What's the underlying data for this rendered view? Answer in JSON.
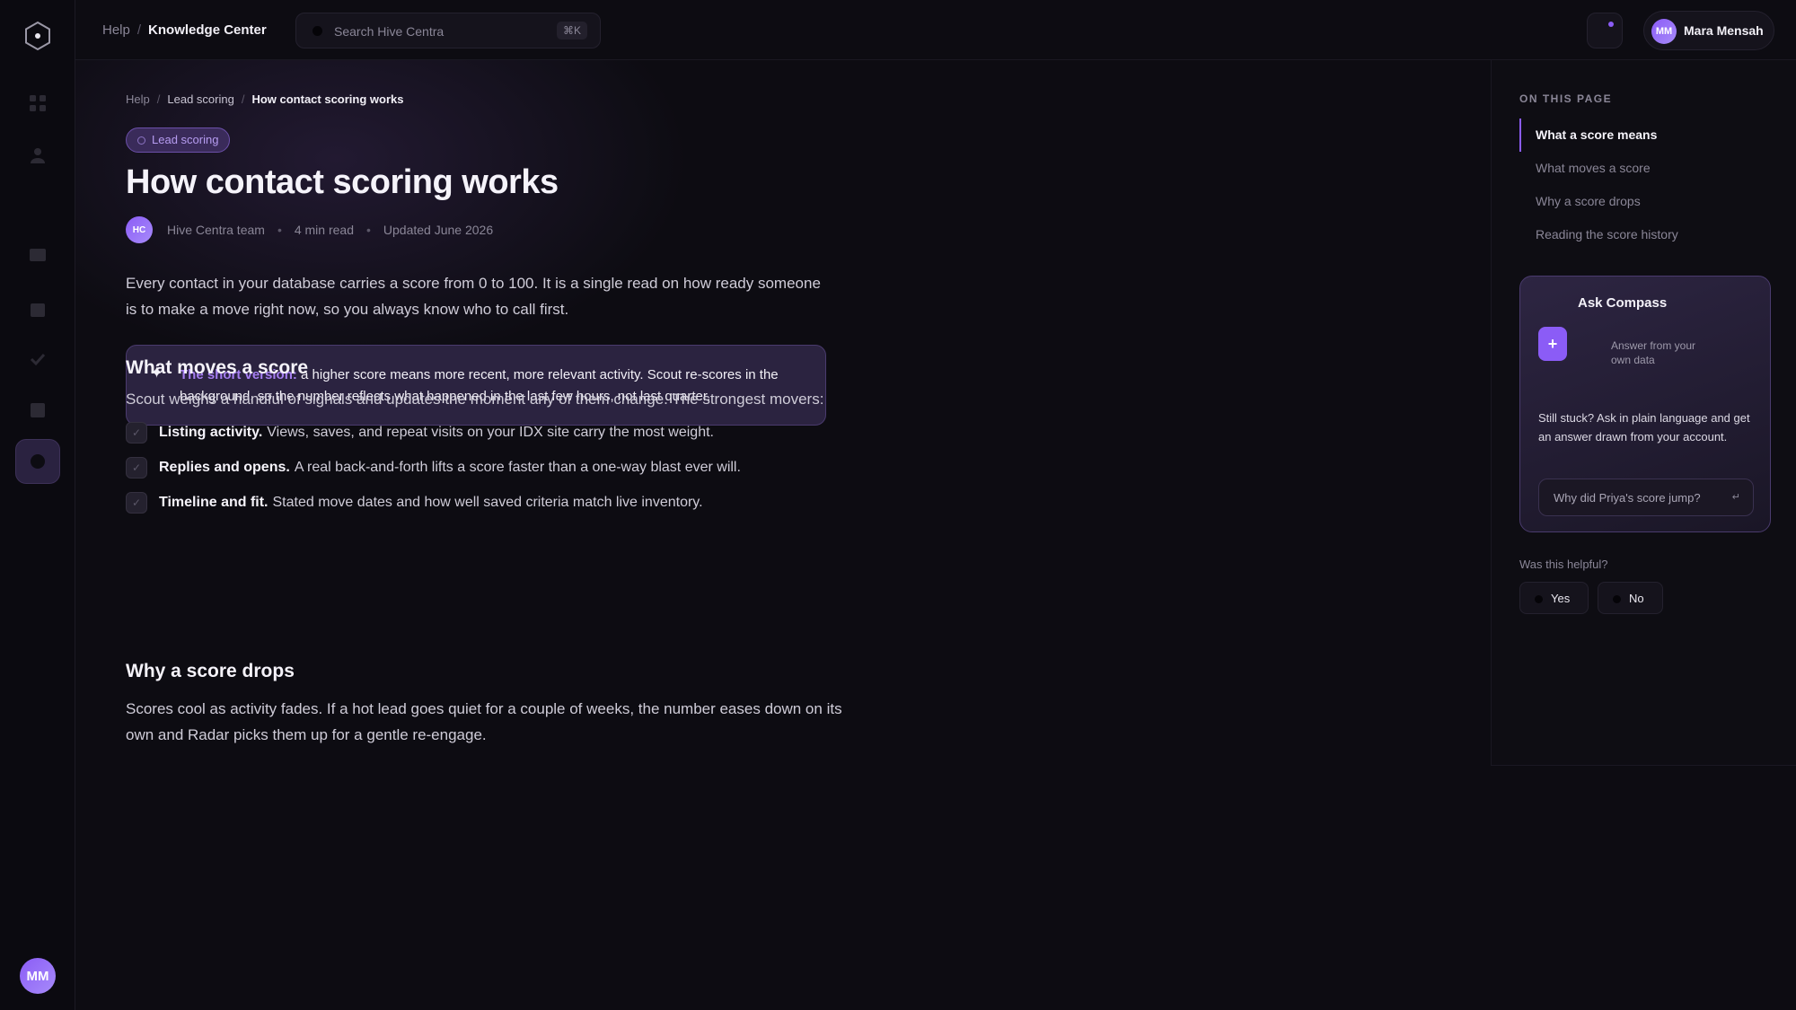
{
  "topbar": {
    "crumb_root": "Help",
    "crumb_current": "Knowledge Center",
    "search_placeholder": "Search Hive Centra",
    "search_shortcut": "⌘K",
    "user_initials": "MM",
    "user_name": "Mara Mensah"
  },
  "rail": {
    "avatar_initials": "MM",
    "icons": [
      "grid-icon",
      "contacts-icon",
      "inbox-icon",
      "calendar-icon",
      "tasks-icon",
      "reports-icon",
      "help-icon"
    ]
  },
  "article": {
    "breadcrumb": [
      "Help",
      "Lead scoring",
      "How contact scoring works"
    ],
    "tag": "Lead scoring",
    "title": "How contact scoring works",
    "author_initials": "HC",
    "author": "Hive Centra team",
    "read_time": "4 min read",
    "updated": "Updated June 2026",
    "intro": "Every contact in your database carries a score from 0 to 100. It is a single read on how ready someone is to make a move right now, so you always know who to call first.",
    "callout": {
      "lead": "The short version:",
      "text": " a higher score means more recent, more relevant activity. Scout re-scores in the background, so the number reflects what happened in the last few hours, not last quarter."
    },
    "section1": {
      "heading": "What moves a score",
      "intro": "Scout weighs a handful of signals and updates the moment any of them change. The strongest movers:",
      "items": [
        {
          "bold": "Listing activity.",
          "text": "Views, saves, and repeat visits on your IDX site carry the most weight."
        },
        {
          "bold": "Replies and opens.",
          "text": "A real back-and-forth lifts a score faster than a one-way blast ever will."
        },
        {
          "bold": "Timeline and fit.",
          "text": "Stated move dates and how well saved criteria match live inventory."
        }
      ]
    },
    "section2": {
      "heading": "Why a score drops",
      "body": "Scores cool as activity fades. If a hot lead goes quiet for a couple of weeks, the number eases down on its own and Radar picks them up for a gentle re-engage."
    }
  },
  "aside": {
    "on_this_page": "ON THIS PAGE",
    "toc": [
      "What a score means",
      "What moves a score",
      "Why a score drops",
      "Reading the score history"
    ],
    "ask": {
      "title": "Ask Compass",
      "icon": "+",
      "subtitle": "Answer from your own data",
      "description": "Still stuck? Ask in plain language and get an answer drawn from your account.",
      "input_placeholder": "Why did Priya's score jump?",
      "send_glyph": "↵"
    },
    "helpful": "Was this helpful?",
    "yes": "Yes",
    "no": "No"
  },
  "colors": {
    "accent": "#8b5cf6",
    "accent_text": "#a57ef0",
    "background": "#0d0c12"
  }
}
